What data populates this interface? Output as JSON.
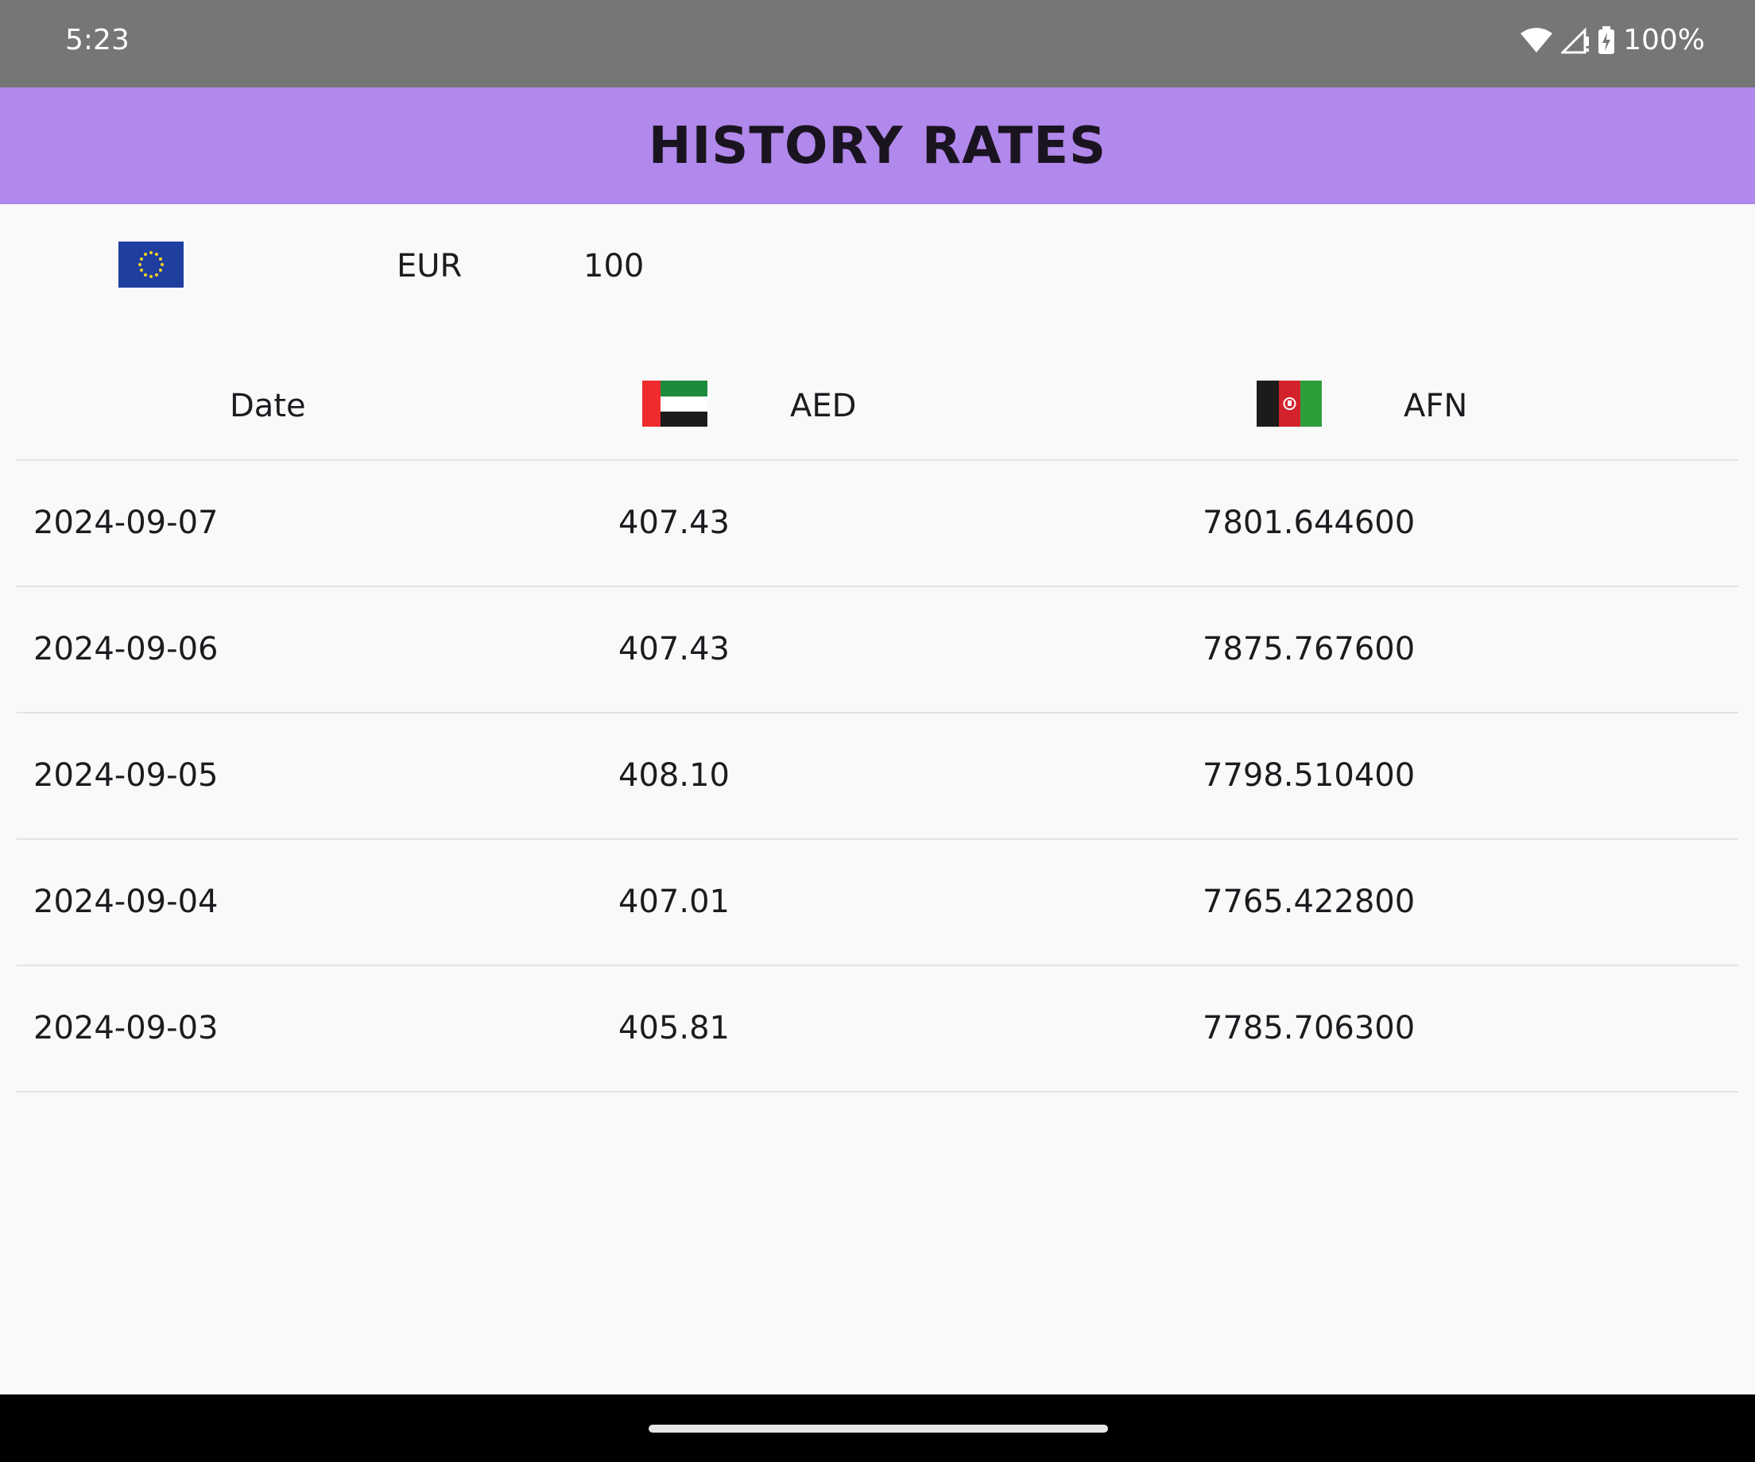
{
  "status_bar": {
    "time": "5:23",
    "battery": "100%",
    "icons": [
      "wifi-icon",
      "cellular-signal-icon",
      "battery-charging-icon"
    ]
  },
  "app_bar": {
    "title": "HISTORY RATES",
    "background": "#b188eb"
  },
  "base_currency": {
    "flag": "eu-flag-icon",
    "code": "EUR",
    "amount": "100"
  },
  "table": {
    "columns": [
      {
        "label": "Date"
      },
      {
        "label": "AED",
        "flag": "uae-flag-icon"
      },
      {
        "label": "AFN",
        "flag": "afghanistan-flag-icon"
      }
    ],
    "rows": [
      {
        "date": "2024-09-07",
        "aed": "407.43",
        "afn": "7801.644600"
      },
      {
        "date": "2024-09-06",
        "aed": "407.43",
        "afn": "7875.767600"
      },
      {
        "date": "2024-09-05",
        "aed": "408.10",
        "afn": "7798.510400"
      },
      {
        "date": "2024-09-04",
        "aed": "407.01",
        "afn": "7765.422800"
      },
      {
        "date": "2024-09-03",
        "aed": "405.81",
        "afn": "7785.706300"
      }
    ]
  }
}
